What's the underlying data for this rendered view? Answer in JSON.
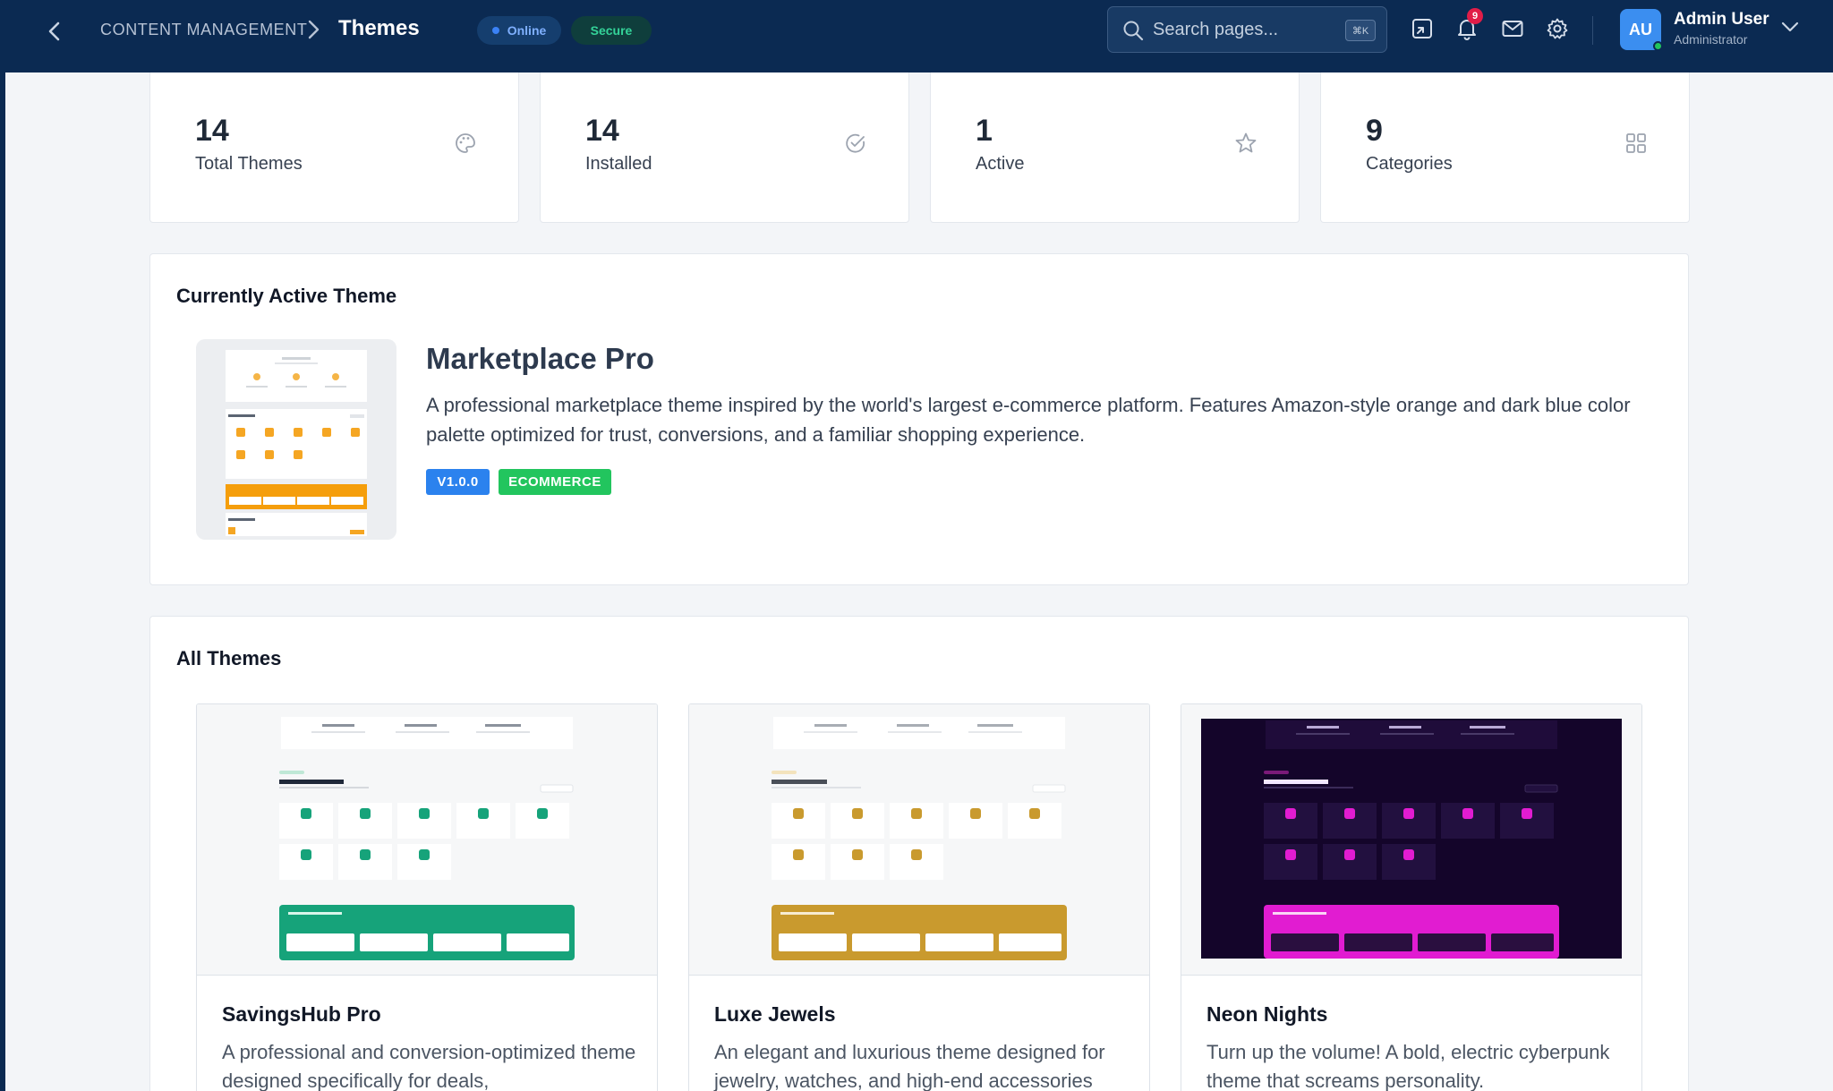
{
  "header": {
    "breadcrumb_parent": "CONTENT MANAGEMENT",
    "page_title": "Themes",
    "status_online": "Online",
    "status_secure": "Secure",
    "search_placeholder": "Search pages...",
    "search_shortcut": "⌘K",
    "notification_count": "9",
    "user_initials": "AU",
    "user_name": "Admin User",
    "user_role": "Administrator",
    "icons": [
      "back-chevron-icon",
      "chevron-right-icon",
      "search-icon",
      "exit-fullscreen-icon",
      "bell-icon",
      "mail-icon",
      "gear-icon",
      "chevron-down-icon"
    ]
  },
  "stats": [
    {
      "value": "14",
      "label": "Total Themes",
      "icon": "palette-icon"
    },
    {
      "value": "14",
      "label": "Installed",
      "icon": "check-circle-icon"
    },
    {
      "value": "1",
      "label": "Active",
      "icon": "star-icon"
    },
    {
      "value": "9",
      "label": "Categories",
      "icon": "grid-icon"
    }
  ],
  "active_theme": {
    "section_title": "Currently Active Theme",
    "name": "Marketplace Pro",
    "description": "A professional marketplace theme inspired by the world's largest e-commerce platform. Features Amazon-style orange and dark blue color palette optimized for trust, conversions, and a familiar shopping experience.",
    "version": "V1.0.0",
    "category": "ECOMMERCE",
    "accent": "#f59e0b"
  },
  "all_themes": {
    "section_title": "All Themes",
    "items": [
      {
        "name": "SavingsHub Pro",
        "description": "A professional and conversion-optimized theme designed specifically for deals,",
        "accent": "#16a37a",
        "background": "#f6f7f8"
      },
      {
        "name": "Luxe Jewels",
        "description": "An elegant and luxurious theme designed for jewelry, watches, and high-end accessories",
        "accent": "#c99a2e",
        "background": "#f6f7f8"
      },
      {
        "name": "Neon Nights",
        "description": "Turn up the volume! A bold, electric cyberpunk theme that screams personality.",
        "accent": "#e11cd1",
        "background": "#14052a"
      }
    ]
  },
  "colors": {
    "header_bg": "#0b2a52",
    "page_bg": "#f3f5f8",
    "version_tag": "#2b82ee",
    "category_tag": "#22c55e"
  }
}
